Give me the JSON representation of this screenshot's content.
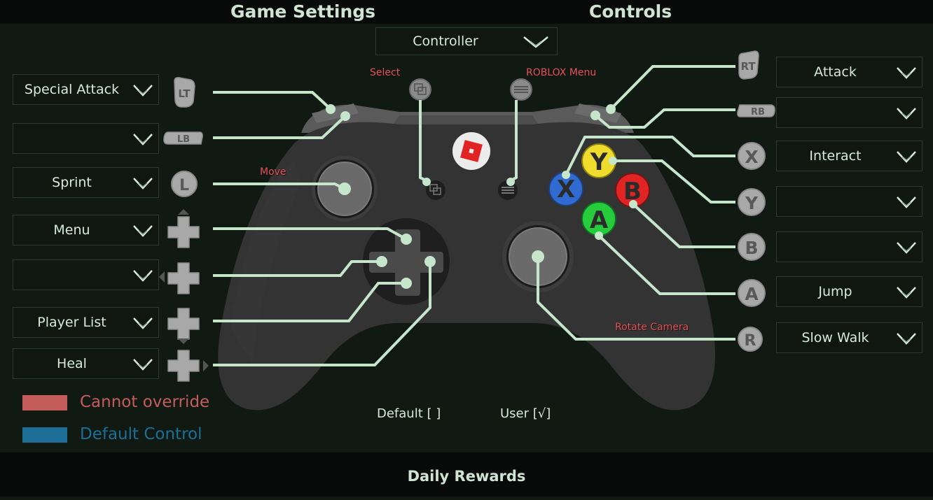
{
  "header": {
    "tabs": [
      {
        "label": "Game Settings"
      },
      {
        "label": "Controls"
      }
    ]
  },
  "scheme_dropdown": {
    "value": "Controller"
  },
  "annotations": {
    "select": "Select",
    "roblox_menu": "ROBLOX Menu",
    "move": "Move",
    "rotate_camera": "Rotate Camera"
  },
  "left_bindings": [
    {
      "button": "LT",
      "action": "Special Attack"
    },
    {
      "button": "LB",
      "action": ""
    },
    {
      "button": "L",
      "action": "Sprint"
    },
    {
      "button": "DPad Up",
      "action": "Menu"
    },
    {
      "button": "DPad Left",
      "action": ""
    },
    {
      "button": "DPad Down",
      "action": "Player List"
    },
    {
      "button": "DPad Right",
      "action": "Heal"
    }
  ],
  "right_bindings": [
    {
      "button": "RT",
      "action": "Attack"
    },
    {
      "button": "RB",
      "action": ""
    },
    {
      "button": "X",
      "action": "Interact"
    },
    {
      "button": "Y",
      "action": ""
    },
    {
      "button": "B",
      "action": ""
    },
    {
      "button": "A",
      "action": "Jump"
    },
    {
      "button": "R",
      "action": "Slow Walk"
    }
  ],
  "face_buttons": {
    "x": {
      "label": "X",
      "color": "#2f6bd0"
    },
    "y": {
      "label": "Y",
      "color": "#f0dc2c"
    },
    "b": {
      "label": "B",
      "color": "#e12424"
    },
    "a": {
      "label": "A",
      "color": "#27cc3c"
    }
  },
  "legend": [
    {
      "label": "Cannot override",
      "color": "#c45c5c"
    },
    {
      "label": "Default Control",
      "color": "#1d6f98"
    }
  ],
  "modes": {
    "default": "Default [ ]",
    "user": "User [√]"
  },
  "footer": {
    "label": "Daily Rewards"
  },
  "colors": {
    "line": "#c6e6cc",
    "controller_body": "#333333",
    "accent_text": "#cfe4d2",
    "roblox_red": "#e22323"
  }
}
